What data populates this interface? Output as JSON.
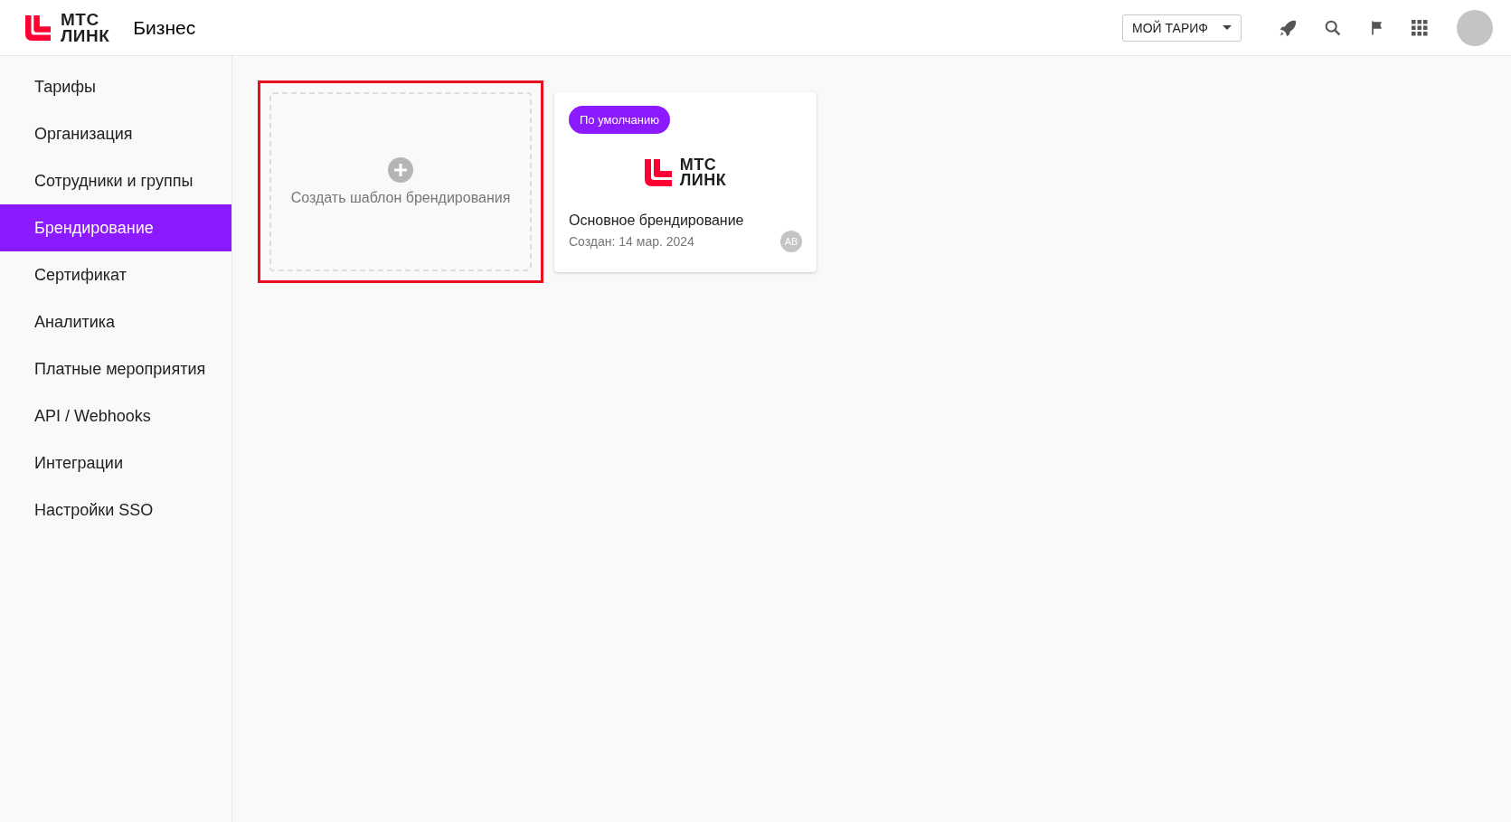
{
  "header": {
    "logo_lines": [
      "МТС",
      "ЛИНК"
    ],
    "product": "Бизнес",
    "tariff_button": "МОЙ ТАРИФ"
  },
  "sidebar": {
    "items": [
      {
        "label": "Тарифы",
        "selected": false
      },
      {
        "label": "Организация",
        "selected": false
      },
      {
        "label": "Сотрудники и группы",
        "selected": false
      },
      {
        "label": "Брендирование",
        "selected": true
      },
      {
        "label": "Сертификат",
        "selected": false
      },
      {
        "label": "Аналитика",
        "selected": false
      },
      {
        "label": "Платные мероприятия",
        "selected": false
      },
      {
        "label": "API / Webhooks",
        "selected": false
      },
      {
        "label": "Интеграции",
        "selected": false
      },
      {
        "label": "Настройки SSO",
        "selected": false
      }
    ]
  },
  "create_card": {
    "label": "Создать шаблон брендирования",
    "highlighted": true
  },
  "templates": [
    {
      "badge": "По умолчанию",
      "logo_lines": [
        "МТС",
        "ЛИНК"
      ],
      "name": "Основное брендирование",
      "created": "Создан: 14 мар. 2024",
      "author_initials": "АВ"
    }
  ]
}
